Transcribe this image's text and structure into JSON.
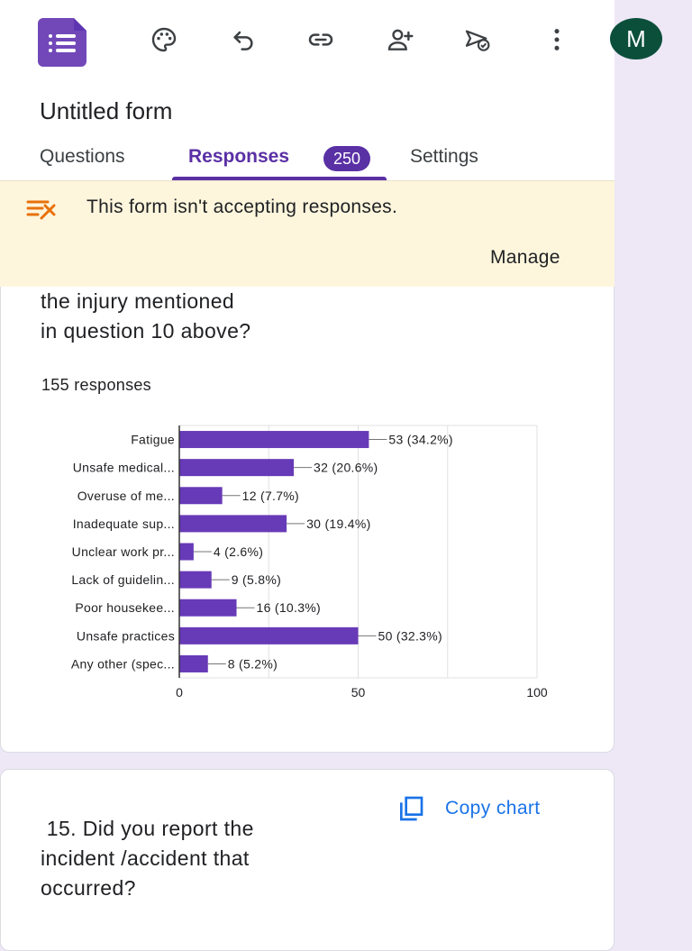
{
  "header": {
    "avatar_letter": "M",
    "form_title": "Untitled form",
    "icons": [
      "palette-icon",
      "undo-icon",
      "link-icon",
      "add-collaborator-icon",
      "send-icon",
      "more-vert-icon"
    ]
  },
  "tabs": [
    {
      "label": "Questions"
    },
    {
      "label": "Responses",
      "badge": "250"
    },
    {
      "label": "Settings"
    }
  ],
  "banner": {
    "text": "This form isn't accepting responses.",
    "action": "Manage"
  },
  "card1": {
    "question_lines": [
      "the injury mentioned",
      "in question 10 above?"
    ],
    "responses_count": "155 responses"
  },
  "chart_data": {
    "type": "bar",
    "orientation": "horizontal",
    "categories": [
      "Fatigue",
      "Unsafe medical...",
      "Overuse of me...",
      "Inadequate sup...",
      "Unclear work pr...",
      "Lack of guidelin...",
      "Poor housekee...",
      "Unsafe practices",
      "Any other (spec..."
    ],
    "values": [
      53,
      32,
      12,
      30,
      4,
      9,
      16,
      50,
      8
    ],
    "labels": [
      "53 (34.2%)",
      "32 (20.6%)",
      "12 (7.7%)",
      "30 (19.4%)",
      "4 (2.6%)",
      "9 (5.8%)",
      "16 (10.3%)",
      "50 (32.3%)",
      "8 (5.2%)"
    ],
    "xlim": [
      0,
      100
    ],
    "xticks": [
      0,
      50,
      100
    ],
    "grid": true,
    "bar_color": "#673ab7"
  },
  "card2": {
    "copy_chart": "Copy chart",
    "question_lines": [
      " 15. Did you report the",
      "incident /accident that",
      "occurred?"
    ]
  },
  "colors": {
    "accent": "#5a30a5",
    "banner_bg": "#fdf6dd",
    "link_blue": "#1a73e8",
    "avatar_bg": "#0b4f3b"
  }
}
